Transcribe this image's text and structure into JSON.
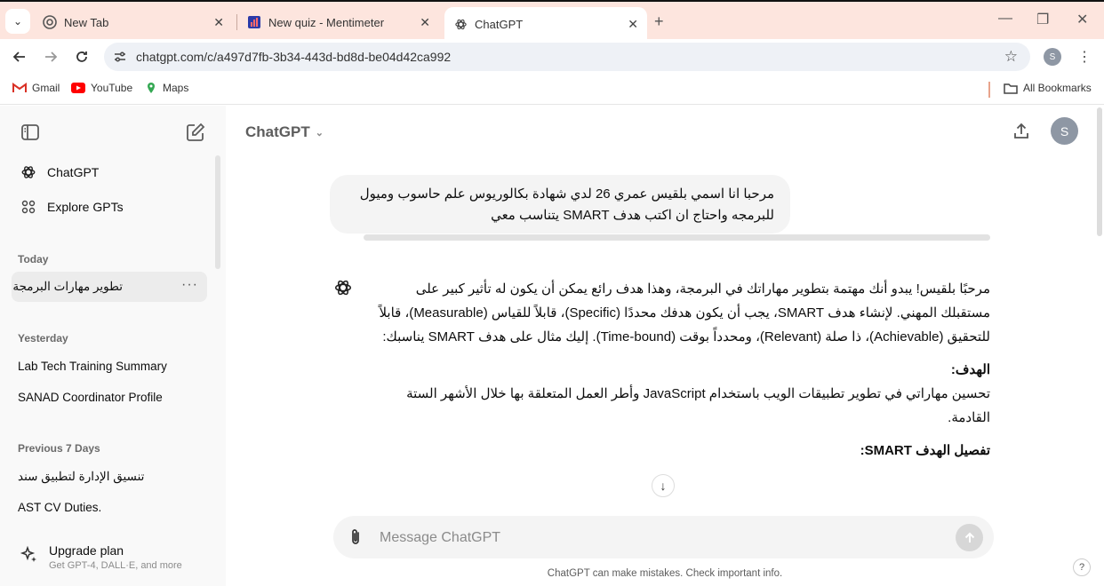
{
  "browser": {
    "tabs": [
      {
        "title": "New Tab",
        "icon": "chrome-icon"
      },
      {
        "title": "New quiz - Mentimeter",
        "icon": "mentimeter-icon"
      },
      {
        "title": "ChatGPT",
        "icon": "openai-icon",
        "active": true
      }
    ],
    "url": "chatgpt.com/c/a497d7fb-3b34-443d-bd8d-be04d42ca992",
    "profile_initial": "S",
    "bookmarks": [
      "Gmail",
      "YouTube",
      "Maps"
    ],
    "all_bookmarks": "All Bookmarks"
  },
  "sidebar": {
    "nav": [
      {
        "label": "ChatGPT",
        "icon": "openai-icon"
      },
      {
        "label": "Explore GPTs",
        "icon": "grid-icon"
      }
    ],
    "sections": [
      {
        "heading": "Today",
        "items": [
          "تطوير مهارات البرمجة"
        ]
      },
      {
        "heading": "Yesterday",
        "items": [
          "Lab Tech Training Summary",
          "SANAD Coordinator Profile"
        ]
      },
      {
        "heading": "Previous 7 Days",
        "items": [
          "تنسيق الإدارة لتطبيق سند",
          "AST CV Duties."
        ]
      }
    ],
    "upgrade": {
      "title": "Upgrade plan",
      "subtitle": "Get GPT-4, DALL·E, and more"
    }
  },
  "main": {
    "model": "ChatGPT",
    "avatar_initial": "S",
    "user_message": "مرحبا انا اسمي بلقيس عمري 26 لدي شهادة بكالوريوس علم حاسوب وميول للبرمجه واحتاج ان اكتب هدف SMART يتناسب معي",
    "assistant": {
      "intro": "مرحبًا بلقيس! يبدو أنك مهتمة بتطوير مهاراتك في البرمجة، وهذا هدف رائع يمكن أن يكون له تأثير كبير على مستقبلك المهني. لإنشاء هدف SMART، يجب أن يكون هدفك محددًا (Specific)، قابلاً للقياس (Measurable)، قابلاً للتحقيق (Achievable)، ذا صلة (Relevant)، ومحدداً بوقت (Time-bound). إليك مثال على هدف SMART يناسبك:",
      "goal_heading": "الهدف:",
      "goal_text": "تحسين مهاراتي في تطوير تطبيقات الويب باستخدام JavaScript وأطر العمل المتعلقة بها خلال الأشهر الستة القادمة.",
      "details_heading": "تفصيل الهدف SMART:"
    },
    "composer_placeholder": "Message ChatGPT",
    "disclaimer": "ChatGPT can make mistakes. Check important info.",
    "help": "?"
  }
}
